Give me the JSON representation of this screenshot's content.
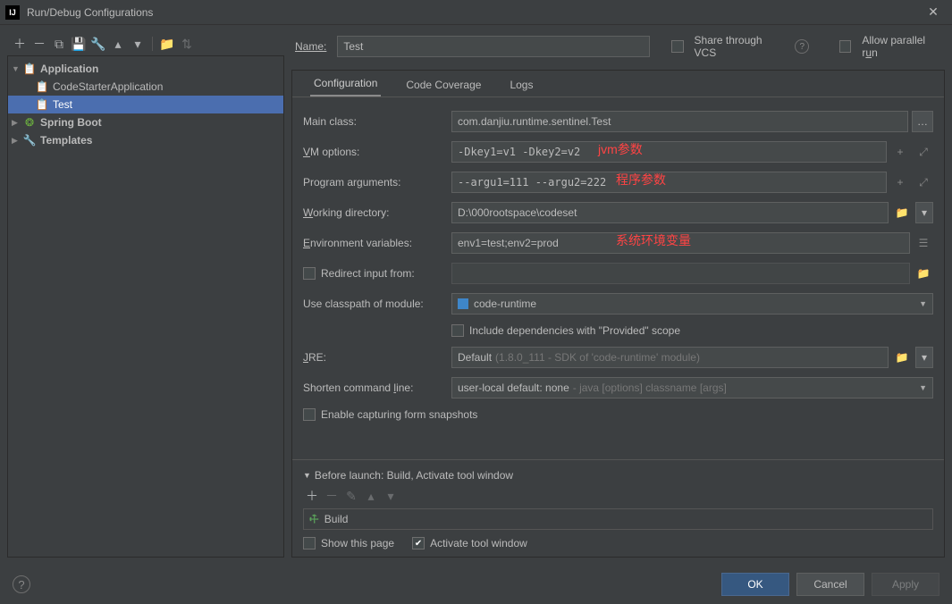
{
  "window": {
    "title": "Run/Debug Configurations"
  },
  "tree": {
    "root1": {
      "label": "Application"
    },
    "child1": {
      "label": "CodeStarterApplication"
    },
    "child2": {
      "label": "Test"
    },
    "root2": {
      "label": "Spring Boot"
    },
    "root3": {
      "label": "Templates"
    }
  },
  "nameRow": {
    "label": "Name:",
    "value": "Test",
    "share": "Share through VCS",
    "parallel": "Allow parallel run"
  },
  "tabs": {
    "t1": "Configuration",
    "t2": "Code Coverage",
    "t3": "Logs"
  },
  "form": {
    "mainClass": {
      "label": "Main class:",
      "value": "com.danjiu.runtime.sentinel.Test"
    },
    "vmOptions": {
      "label": "VM options:",
      "value": "-Dkey1=v1 -Dkey2=v2",
      "annot": "jvm参数"
    },
    "progArgs": {
      "label": "Program arguments:",
      "value": "--argu1=111 --argu2=222",
      "annot": "程序参数"
    },
    "workDir": {
      "label": "Working directory:",
      "value": "D:\\000rootspace\\codeset"
    },
    "envVars": {
      "label": "Environment variables:",
      "value": "env1=test;env2=prod",
      "annot": "系统环境变量"
    },
    "redirect": {
      "label": "Redirect input from:"
    },
    "classpath": {
      "label": "Use classpath of module:",
      "value": "code-runtime"
    },
    "includeProvided": {
      "label": "Include dependencies with \"Provided\" scope"
    },
    "jre": {
      "label": "JRE:",
      "value": "Default",
      "hint": "(1.8.0_111 - SDK of 'code-runtime' module)"
    },
    "shorten": {
      "label": "Shorten command line:",
      "value": "user-local default: none",
      "hint": "- java [options] classname [args]"
    },
    "snapshots": {
      "label": "Enable capturing form snapshots"
    }
  },
  "beforeLaunch": {
    "header": "Before launch: Build, Activate tool window",
    "item": "Build",
    "showPage": "Show this page",
    "activate": "Activate tool window"
  },
  "footer": {
    "ok": "OK",
    "cancel": "Cancel",
    "apply": "Apply"
  }
}
